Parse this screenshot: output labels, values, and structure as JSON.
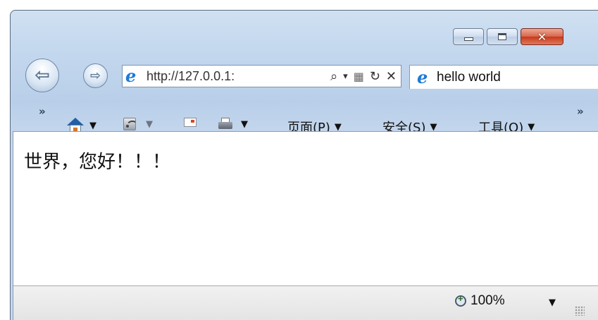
{
  "window": {
    "caption_buttons": {
      "minimize_icon": "minimize-icon",
      "maximize_icon": "maximize-icon",
      "close_label": "✕"
    }
  },
  "navigation": {
    "back_glyph": "⇦",
    "forward_glyph": "⇨",
    "address": {
      "url": "http://127.0.0.1:",
      "search_glyph": "⌕",
      "dropdown_glyph": "▾",
      "compat_glyph": "▦",
      "refresh_glyph": "↻",
      "stop_glyph": "✕"
    },
    "tab": {
      "title": "hello world"
    }
  },
  "command_bar": {
    "overflow_left": "»",
    "overflow_right": "»",
    "dropdown_glyph": "▼",
    "page_menu": "页面(P)",
    "safety_menu": "安全(S)",
    "tools_menu": "工具(O)"
  },
  "page": {
    "body_text": "世界，您好！！！"
  },
  "status_bar": {
    "zoom_level": "100%",
    "zoom_dropdown": "▼"
  },
  "colors": {
    "frame": "#c3d7ee",
    "close_button": "#c8391c",
    "ie_blue": "#1f7ad6"
  }
}
